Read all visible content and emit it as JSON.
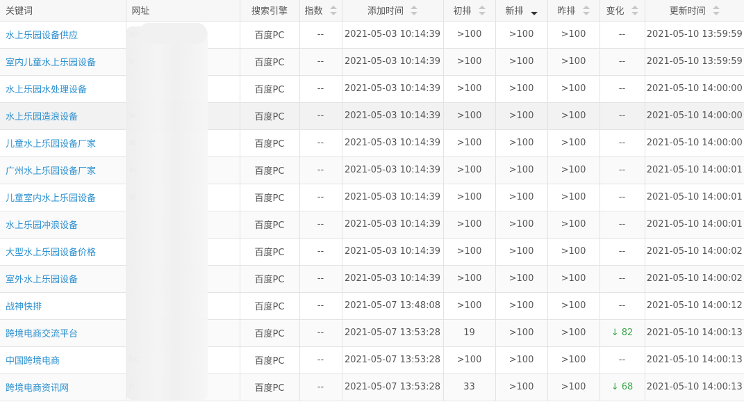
{
  "table": {
    "headers": {
      "keyword": "关键词",
      "url": "网址",
      "engine": "搜索引擎",
      "index": "指数",
      "added": "添加时间",
      "first_rank": "初排",
      "new_rank": "新排",
      "yesterday_rank": "昨排",
      "change": "变化",
      "updated": "更新时间"
    },
    "rows": [
      {
        "keyword": "水上乐园设备供应",
        "url": "ww",
        "engine": "百度PC",
        "index": "--",
        "added": "2021-05-03 10:14:39",
        "first": ">100",
        "new": ">100",
        "yesterday": ">100",
        "change_arrow": "",
        "change": "--",
        "updated": "2021-05-10 13:59:59"
      },
      {
        "keyword": "室内儿童水上乐园设备",
        "url": "v",
        "engine": "百度PC",
        "index": "--",
        "added": "2021-05-03 10:14:39",
        "first": ">100",
        "new": ">100",
        "yesterday": ">100",
        "change_arrow": "",
        "change": "--",
        "updated": "2021-05-10 13:59:59"
      },
      {
        "keyword": "水上乐园水处理设备",
        "url": "",
        "engine": "百度PC",
        "index": "--",
        "added": "2021-05-03 10:14:39",
        "first": ">100",
        "new": ">100",
        "yesterday": ">100",
        "change_arrow": "",
        "change": "--",
        "updated": "2021-05-10 14:00:00"
      },
      {
        "keyword": "水上乐园造浪设备",
        "url": "w",
        "engine": "百度PC",
        "index": "--",
        "added": "2021-05-03 10:14:39",
        "first": ">100",
        "new": ">100",
        "yesterday": ">100",
        "change_arrow": "",
        "change": "--",
        "updated": "2021-05-10 14:00:00"
      },
      {
        "keyword": "儿童水上乐园设备厂家",
        "url": "w",
        "engine": "百度PC",
        "index": "--",
        "added": "2021-05-03 10:14:39",
        "first": ">100",
        "new": ">100",
        "yesterday": ">100",
        "change_arrow": "",
        "change": "--",
        "updated": "2021-05-10 14:00:00"
      },
      {
        "keyword": "广州水上乐园设备厂家",
        "url": "w",
        "engine": "百度PC",
        "index": "--",
        "added": "2021-05-03 10:14:39",
        "first": ">100",
        "new": ">100",
        "yesterday": ">100",
        "change_arrow": "",
        "change": "--",
        "updated": "2021-05-10 14:00:01"
      },
      {
        "keyword": "儿童室内水上乐园设备",
        "url": "w",
        "engine": "百度PC",
        "index": "--",
        "added": "2021-05-03 10:14:39",
        "first": ">100",
        "new": ">100",
        "yesterday": ">100",
        "change_arrow": "",
        "change": "--",
        "updated": "2021-05-10 14:00:01"
      },
      {
        "keyword": "水上乐园冲浪设备",
        "url": "",
        "engine": "百度PC",
        "index": "--",
        "added": "2021-05-03 10:14:39",
        "first": ">100",
        "new": ">100",
        "yesterday": ">100",
        "change_arrow": "",
        "change": "--",
        "updated": "2021-05-10 14:00:01"
      },
      {
        "keyword": "大型水上乐园设备价格",
        "url": "",
        "engine": "百度PC",
        "index": "--",
        "added": "2021-05-03 10:14:39",
        "first": ">100",
        "new": ">100",
        "yesterday": ">100",
        "change_arrow": "",
        "change": "--",
        "updated": "2021-05-10 14:00:02"
      },
      {
        "keyword": "室外水上乐园设备",
        "url": "",
        "engine": "百度PC",
        "index": "--",
        "added": "2021-05-03 10:14:39",
        "first": ">100",
        "new": ">100",
        "yesterday": ">100",
        "change_arrow": "",
        "change": "--",
        "updated": "2021-05-10 14:00:02"
      },
      {
        "keyword": "战神快排",
        "url": "",
        "engine": "百度PC",
        "index": "--",
        "added": "2021-05-07 13:48:08",
        "first": ">100",
        "new": ">100",
        "yesterday": ">100",
        "change_arrow": "",
        "change": "--",
        "updated": "2021-05-10 14:00:12"
      },
      {
        "keyword": "跨境电商交流平台",
        "url": "",
        "engine": "百度PC",
        "index": "--",
        "added": "2021-05-07 13:53:28",
        "first": "19",
        "new": ">100",
        "yesterday": ">100",
        "change_arrow": "↓",
        "change": "82",
        "updated": "2021-05-10 14:00:13"
      },
      {
        "keyword": "中国跨境电商",
        "url": "hc",
        "engine": "百度PC",
        "index": "--",
        "added": "2021-05-07 13:53:28",
        "first": ">100",
        "new": ">100",
        "yesterday": ">100",
        "change_arrow": "",
        "change": "--",
        "updated": "2021-05-10 14:00:13"
      },
      {
        "keyword": "跨境电商资讯网",
        "url": "h",
        "engine": "百度PC",
        "index": "--",
        "added": "2021-05-07 13:53:28",
        "first": "33",
        "new": ">100",
        "yesterday": ">100",
        "change_arrow": "↓",
        "change": "68",
        "updated": "2021-05-10 14:00:13"
      }
    ]
  },
  "colors": {
    "keyword_link": "#2a8fcf",
    "rank_down": "#3aa94b",
    "header_bg": "#f7f7f7"
  }
}
